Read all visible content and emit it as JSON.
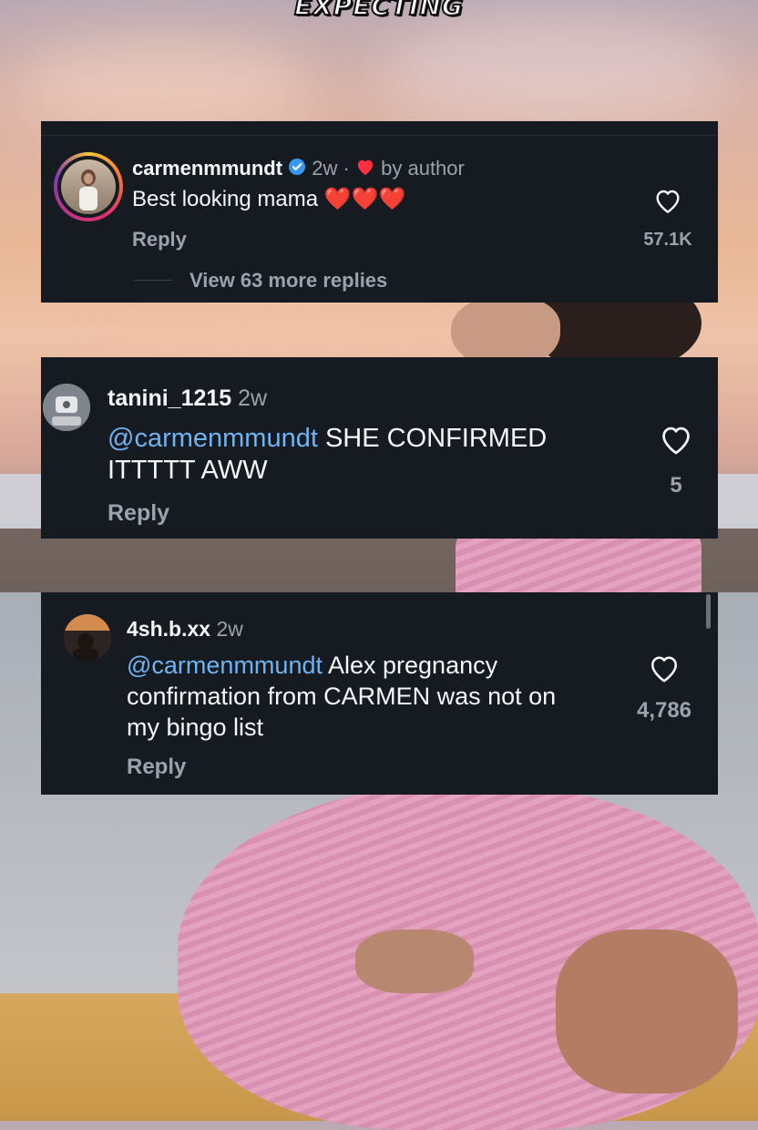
{
  "header": {
    "title": "EXPECTING"
  },
  "comments": [
    {
      "username": "carmenmmundt",
      "verified": true,
      "time": "2w",
      "separator": "·",
      "liked_by_author": "by author",
      "text": "Best looking mama ❤️❤️❤️",
      "reply_label": "Reply",
      "likes": "57.1K",
      "view_replies": "View 63 more replies"
    },
    {
      "username": "tanini_1215",
      "time": "2w",
      "mention": "@carmenmmundt",
      "text": " SHE CONFIRMED ITTTTT AWW",
      "reply_label": "Reply",
      "likes": "5"
    },
    {
      "username": "4sh.b.xx",
      "time": "2w",
      "mention": "@carmenmmundt",
      "text": " Alex pregnancy confirmation from CARMEN was not on my bingo list",
      "reply_label": "Reply",
      "likes": "4,786"
    }
  ],
  "icons": {
    "verified": "verified-badge-icon",
    "heart": "heart-outline-icon",
    "author_heart": "heart-filled-icon"
  },
  "colors": {
    "card_bg": "#161b22",
    "mention": "#6fb3f0",
    "muted": "#9aa3ad",
    "verified": "#3897f0",
    "author_heart": "#ff3040"
  }
}
